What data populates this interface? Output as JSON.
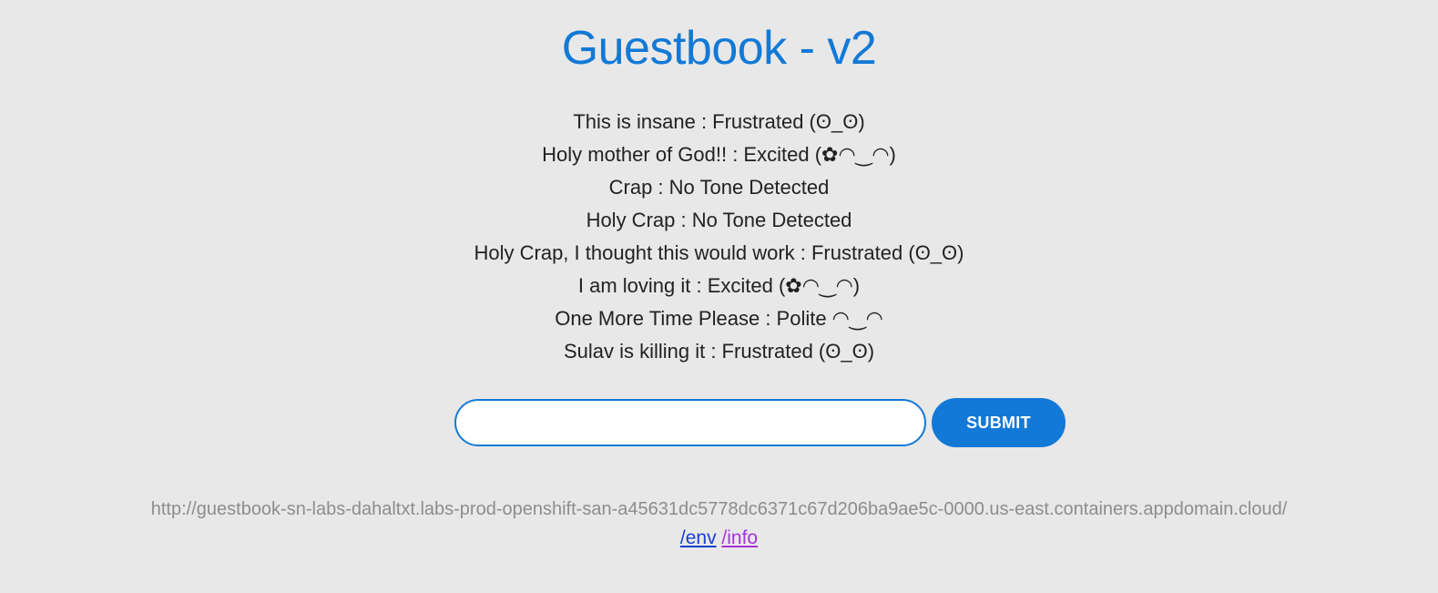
{
  "header": {
    "title": "Guestbook - v2"
  },
  "entries": [
    "This is insane : Frustrated (ʘ_ʘ)",
    "Holy mother of God!! : Excited (✿◠‿◠)",
    "Crap : No Tone Detected",
    "Holy Crap : No Tone Detected",
    "Holy Crap, I thought this would work : Frustrated (ʘ_ʘ)",
    "I am loving it : Excited (✿◠‿◠)",
    "One More Time Please : Polite ◠‿◠",
    "Sulav is killing it : Frustrated (ʘ_ʘ)"
  ],
  "form": {
    "input_value": "",
    "input_placeholder": "",
    "submit_label": "SUBMIT"
  },
  "footer": {
    "host_url": "http://guestbook-sn-labs-dahaltxt.labs-prod-openshift-san-a45631dc5778dc6371c67d206ba9ae5c-0000.us-east.containers.appdomain.cloud/",
    "env_link": "/env",
    "info_link": "/info"
  },
  "colors": {
    "accent": "#1279d6",
    "background": "#e8e8e8",
    "visited_link": "#a633d6",
    "link": "#1a3fd1",
    "muted_text": "#8d8d8d"
  }
}
